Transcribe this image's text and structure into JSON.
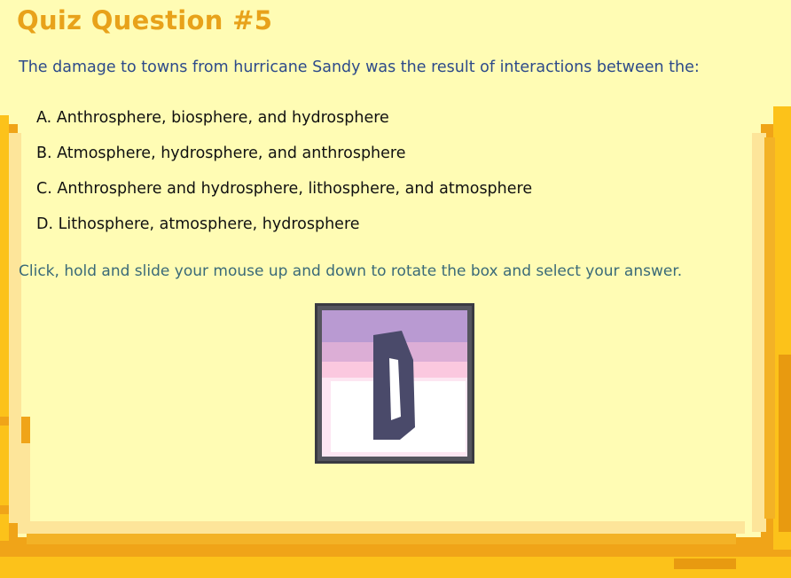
{
  "quiz": {
    "title": "Quiz Question #5",
    "question": "The damage to towns from hurricane Sandy was the result of interactions between the:",
    "options": [
      {
        "letter": "A",
        "text": "A. Anthrosphere, biosphere, and hydrosphere"
      },
      {
        "letter": "B",
        "text": "B. Atmosphere, hydrosphere, and anthrosphere"
      },
      {
        "letter": "C",
        "text": "C. Anthrosphere and hydrosphere, lithosphere, and atmosphere"
      },
      {
        "letter": "D",
        "text": "D. Lithosphere, atmosphere, hydrosphere"
      }
    ],
    "instructions": "Click, hold and slide your mouse up and down to rotate the box and select your answer.",
    "answer_box": {
      "selected_letter": "D"
    }
  },
  "colors": {
    "background": "#fffcb4",
    "frame_orange": "#f0a418",
    "frame_yellow": "#fcc21a",
    "title": "#e8a21a",
    "question": "#2d4a8a",
    "instructions": "#3a6a78",
    "box_border": "#3a3a42",
    "box_letter": "#4a4a6a"
  }
}
